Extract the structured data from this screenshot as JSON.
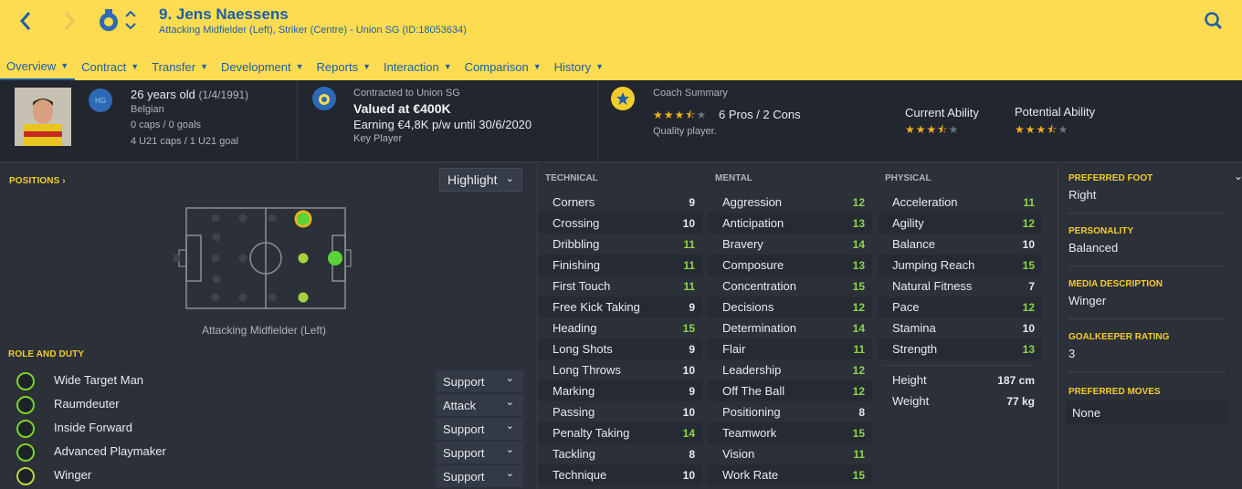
{
  "header": {
    "player_name": "9. Jens Naessens",
    "subtitle": "Attacking Midfielder (Left), Striker (Centre) - Union SG (ID:18053634)",
    "icons": {
      "back": "chevron-left-icon",
      "forward": "chevron-right-icon",
      "search": "search-icon",
      "club": "club-crest-icon"
    }
  },
  "tabs": [
    "Overview",
    "Contract",
    "Transfer",
    "Development",
    "Reports",
    "Interaction",
    "Comparison",
    "History"
  ],
  "profile": {
    "hg_badge": "HG",
    "age": "26 years old",
    "dob": "(1/4/1991)",
    "nationality": "Belgian",
    "caps": "0 caps / 0 goals",
    "u21": "4 U21 caps / 1 U21 goal"
  },
  "contract": {
    "line1": "Contracted to Union SG",
    "valued": "Valued at €400K",
    "earning": "Earning €4,8K p/w until 30/6/2020",
    "status": "Key Player"
  },
  "coach": {
    "title": "Coach Summary",
    "rating_stars": 3.5,
    "pros_cons": "6 Pros / 2 Cons",
    "verdict": "Quality player.",
    "current_label": "Current Ability",
    "current_stars": 3.5,
    "potential_label": "Potential Ability",
    "potential_stars": 3.5
  },
  "positions": {
    "label": "POSITIONS",
    "dropdown": "Highlight",
    "caption": "Attacking Midfielder (Left)"
  },
  "roles": {
    "label": "ROLE AND DUTY",
    "items": [
      {
        "name": "Wide Target Man",
        "duty": "Support"
      },
      {
        "name": "Raumdeuter",
        "duty": "Attack"
      },
      {
        "name": "Inside Forward",
        "duty": "Support"
      },
      {
        "name": "Advanced Playmaker",
        "duty": "Support"
      },
      {
        "name": "Winger",
        "duty": "Support"
      }
    ]
  },
  "technical": {
    "label": "TECHNICAL",
    "items": [
      {
        "name": "Corners",
        "value": "9"
      },
      {
        "name": "Crossing",
        "value": "10"
      },
      {
        "name": "Dribbling",
        "value": "11"
      },
      {
        "name": "Finishing",
        "value": "11"
      },
      {
        "name": "First Touch",
        "value": "11"
      },
      {
        "name": "Free Kick Taking",
        "value": "9"
      },
      {
        "name": "Heading",
        "value": "15"
      },
      {
        "name": "Long Shots",
        "value": "9"
      },
      {
        "name": "Long Throws",
        "value": "10"
      },
      {
        "name": "Marking",
        "value": "9"
      },
      {
        "name": "Passing",
        "value": "10"
      },
      {
        "name": "Penalty Taking",
        "value": "14"
      },
      {
        "name": "Tackling",
        "value": "8"
      },
      {
        "name": "Technique",
        "value": "10"
      }
    ]
  },
  "mental": {
    "label": "MENTAL",
    "items": [
      {
        "name": "Aggression",
        "value": "12"
      },
      {
        "name": "Anticipation",
        "value": "13"
      },
      {
        "name": "Bravery",
        "value": "14"
      },
      {
        "name": "Composure",
        "value": "13"
      },
      {
        "name": "Concentration",
        "value": "15"
      },
      {
        "name": "Decisions",
        "value": "12"
      },
      {
        "name": "Determination",
        "value": "14"
      },
      {
        "name": "Flair",
        "value": "11"
      },
      {
        "name": "Leadership",
        "value": "12"
      },
      {
        "name": "Off The Ball",
        "value": "12"
      },
      {
        "name": "Positioning",
        "value": "8"
      },
      {
        "name": "Teamwork",
        "value": "15"
      },
      {
        "name": "Vision",
        "value": "11"
      },
      {
        "name": "Work Rate",
        "value": "15"
      }
    ]
  },
  "physical": {
    "label": "PHYSICAL",
    "items": [
      {
        "name": "Acceleration",
        "value": "11"
      },
      {
        "name": "Agility",
        "value": "12"
      },
      {
        "name": "Balance",
        "value": "10"
      },
      {
        "name": "Jumping Reach",
        "value": "15"
      },
      {
        "name": "Natural Fitness",
        "value": "7"
      },
      {
        "name": "Pace",
        "value": "12"
      },
      {
        "name": "Stamina",
        "value": "10"
      },
      {
        "name": "Strength",
        "value": "13"
      }
    ],
    "height_label": "Height",
    "height": "187 cm",
    "weight_label": "Weight",
    "weight": "77 kg"
  },
  "info": {
    "foot_label": "PREFERRED FOOT",
    "foot": "Right",
    "personality_label": "PERSONALITY",
    "personality": "Balanced",
    "media_label": "MEDIA DESCRIPTION",
    "media": "Winger",
    "gk_label": "GOALKEEPER RATING",
    "gk": "3",
    "moves_label": "PREFERRED MOVES",
    "moves": "None"
  },
  "colors": {
    "accent": "#fddc51",
    "link": "#1e5ea8",
    "green": "#8ed449",
    "label_yellow": "#f2cc2e"
  }
}
